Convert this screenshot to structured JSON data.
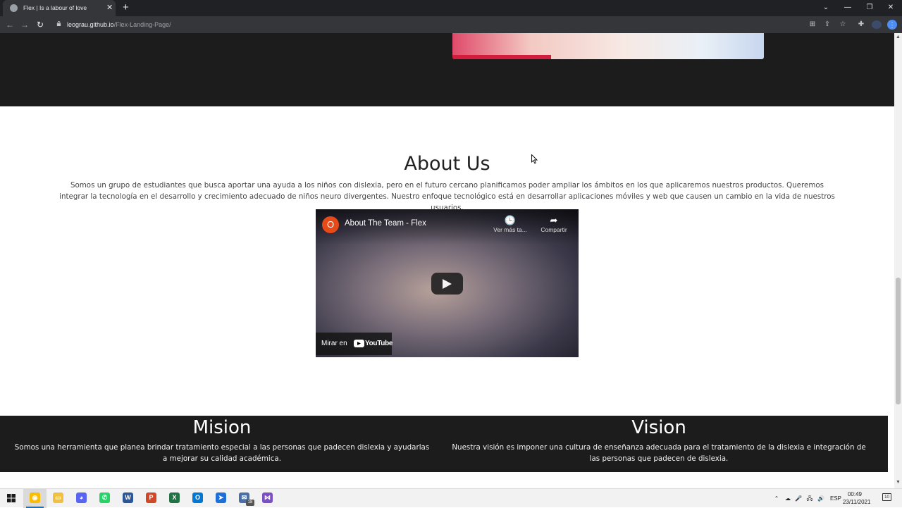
{
  "browser": {
    "tab_title": "Flex | Is a labour of love",
    "tab_close": "✕",
    "new_tab": "+",
    "url_host": "leograu.github.io",
    "url_path": "/Flex-Landing-Page/",
    "window_controls": {
      "tabsearch": "⌄",
      "minimize": "—",
      "restore": "❐",
      "close": "✕"
    }
  },
  "page": {
    "about": {
      "title": "About Us",
      "text": "Somos un grupo de estudiantes que busca aportar una ayuda a los niños con dislexia, pero en el futuro cercano planificamos poder ampliar los ámbitos en los que aplicaremos nuestros productos. Queremos integrar la tecnología en el desarrollo y crecimiento adecuado de niños neuro divergentes. Nuestro enfoque tecnológico está en desarrollar aplicaciones móviles y web que causen un cambio en la vida de nuestros usuarios."
    },
    "video": {
      "channel_initial": "O",
      "title": "About The Team - Flex",
      "watch_later_label": "Ver más ta...",
      "share_label": "Compartir",
      "watch_on_label": "Mirar en",
      "youtube_wordmark": "YouTube"
    },
    "mission": {
      "title": "Mision",
      "text": "Somos una herramienta que planea brindar tratamiento especial a las personas que padecen dislexia y ayudarlas a mejorar su calidad académica."
    },
    "vision": {
      "title": "Vision",
      "text": "Nuestra visión es imponer una cultura de enseñanza adecuada para el tratamiento de la dislexia e integración de las personas que padecen de dislexia."
    }
  },
  "taskbar": {
    "apps": [
      {
        "name": "chrome",
        "color": "#fbbc04",
        "glyph": "◉"
      },
      {
        "name": "file-explorer",
        "color": "#f0c040",
        "glyph": "▭"
      },
      {
        "name": "discord",
        "color": "#5865f2",
        "glyph": "◕"
      },
      {
        "name": "whatsapp",
        "color": "#25d366",
        "glyph": "✆"
      },
      {
        "name": "word",
        "color": "#2b579a",
        "glyph": "W"
      },
      {
        "name": "powerpoint",
        "color": "#d24726",
        "glyph": "P"
      },
      {
        "name": "excel",
        "color": "#217346",
        "glyph": "X"
      },
      {
        "name": "outlook",
        "color": "#0078d4",
        "glyph": "O"
      },
      {
        "name": "app-blue",
        "color": "#1e6fd9",
        "glyph": "➤"
      },
      {
        "name": "mail",
        "color": "#4a6fa5",
        "glyph": "✉"
      },
      {
        "name": "visual-studio",
        "color": "#7b4fc4",
        "glyph": "⋈"
      }
    ],
    "mail_badge": "18",
    "language": "ESP",
    "time": "00:49",
    "date": "23/11/2021",
    "notification_count": "10"
  }
}
